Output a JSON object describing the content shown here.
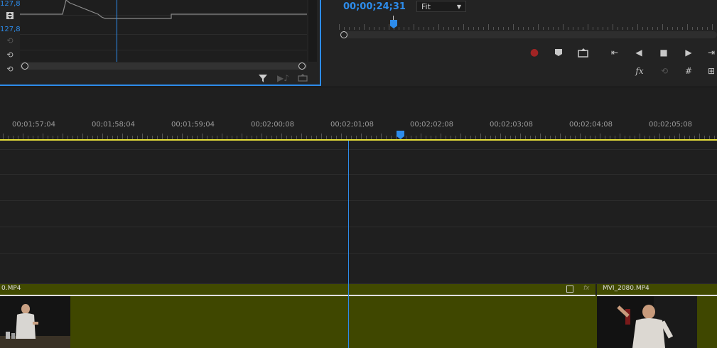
{
  "effects_panel": {
    "value_top": "127,8",
    "value_bottom": "127,8",
    "side_icons": [
      "keyframe-nav-icon",
      "reset-disabled-icon",
      "reset-icon",
      "reset-icon"
    ],
    "bottom_icons": [
      "filter-icon",
      "play-audio-icon",
      "export-icon"
    ]
  },
  "monitor": {
    "timecode": "00;00;24;31",
    "fit": {
      "selected": "Fit"
    },
    "controls_row1": [
      "record-icon",
      "add-marker-icon",
      "export-frame-icon",
      "go-to-in-icon",
      "step-back-icon",
      "stop-icon",
      "step-forward-icon",
      "go-to-out-icon"
    ],
    "controls_row2": [
      {
        "icon": "fx-icon",
        "label": "fx"
      },
      {
        "icon": "loop-icon",
        "label": ""
      },
      {
        "icon": "safe-margins-icon",
        "label": ""
      },
      {
        "icon": "multicam-icon",
        "label": ""
      }
    ]
  },
  "timeline": {
    "ruler_labels": [
      "00;01;57;04",
      "00;01;58;04",
      "00;01;59;04",
      "00;02;00;08",
      "00;02;01;08",
      "00;02;02;08",
      "00;02;03;08",
      "00;02;04;08",
      "00;02;05;08"
    ],
    "clips": [
      {
        "name": "0.MP4"
      },
      {
        "name": "MVI_2080.MP4"
      }
    ],
    "clip_fx_label": "fx"
  },
  "colors": {
    "accent": "#2d8ceb",
    "work_area": "#e8e03a",
    "clip": "#414a00",
    "record": "#a02424"
  }
}
